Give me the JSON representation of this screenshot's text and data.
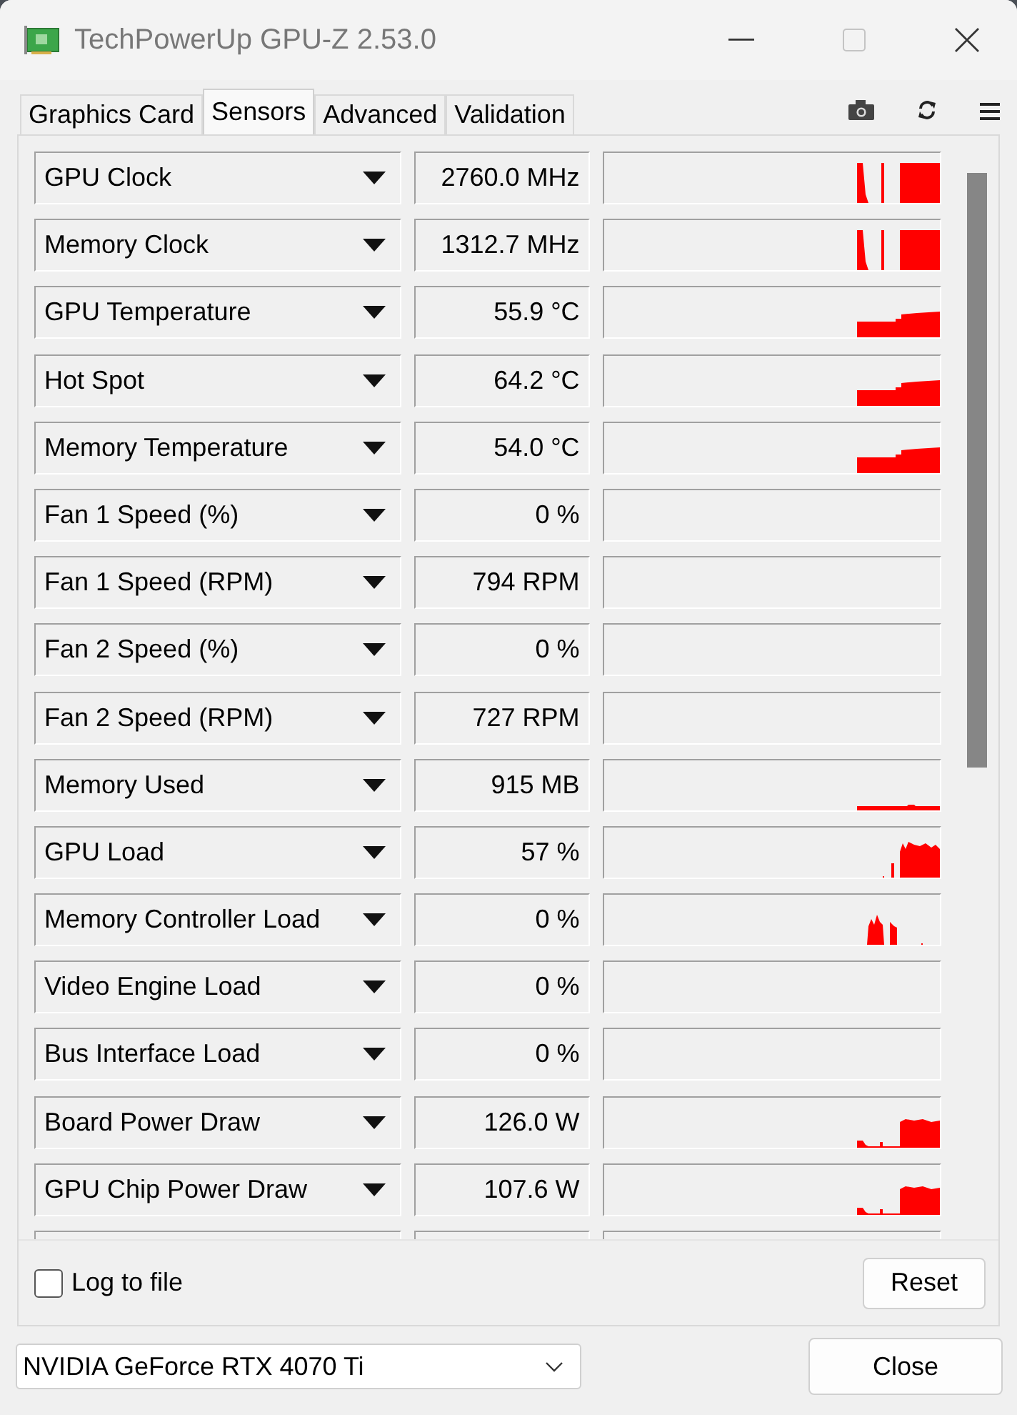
{
  "window": {
    "title": "TechPowerUp GPU-Z 2.53.0"
  },
  "tabs": [
    {
      "label": "Graphics Card",
      "selected": false
    },
    {
      "label": "Sensors",
      "selected": true
    },
    {
      "label": "Advanced",
      "selected": false
    },
    {
      "label": "Validation",
      "selected": false
    }
  ],
  "sensors": [
    {
      "name": "GPU Clock",
      "value": "2760.0 MHz"
    },
    {
      "name": "Memory Clock",
      "value": "1312.7 MHz"
    },
    {
      "name": "GPU Temperature",
      "value": "55.9 °C"
    },
    {
      "name": "Hot Spot",
      "value": "64.2 °C"
    },
    {
      "name": "Memory Temperature",
      "value": "54.0 °C"
    },
    {
      "name": "Fan 1 Speed (%)",
      "value": "0 %"
    },
    {
      "name": "Fan 1 Speed (RPM)",
      "value": "794 RPM"
    },
    {
      "name": "Fan 2 Speed (%)",
      "value": "0 %"
    },
    {
      "name": "Fan 2 Speed (RPM)",
      "value": "727 RPM"
    },
    {
      "name": "Memory Used",
      "value": "915 MB"
    },
    {
      "name": "GPU Load",
      "value": "57 %"
    },
    {
      "name": "Memory Controller Load",
      "value": "0 %"
    },
    {
      "name": "Video Engine Load",
      "value": "0 %"
    },
    {
      "name": "Bus Interface Load",
      "value": "0 %"
    },
    {
      "name": "Board Power Draw",
      "value": "126.0 W"
    },
    {
      "name": "GPU Chip Power Draw",
      "value": "107.6 W"
    }
  ],
  "log_to_file": {
    "label": "Log to file",
    "checked": false
  },
  "reset_button": "Reset",
  "device_select": {
    "value": "NVIDIA GeForce RTX 4070 Ti"
  },
  "close_button": "Close"
}
